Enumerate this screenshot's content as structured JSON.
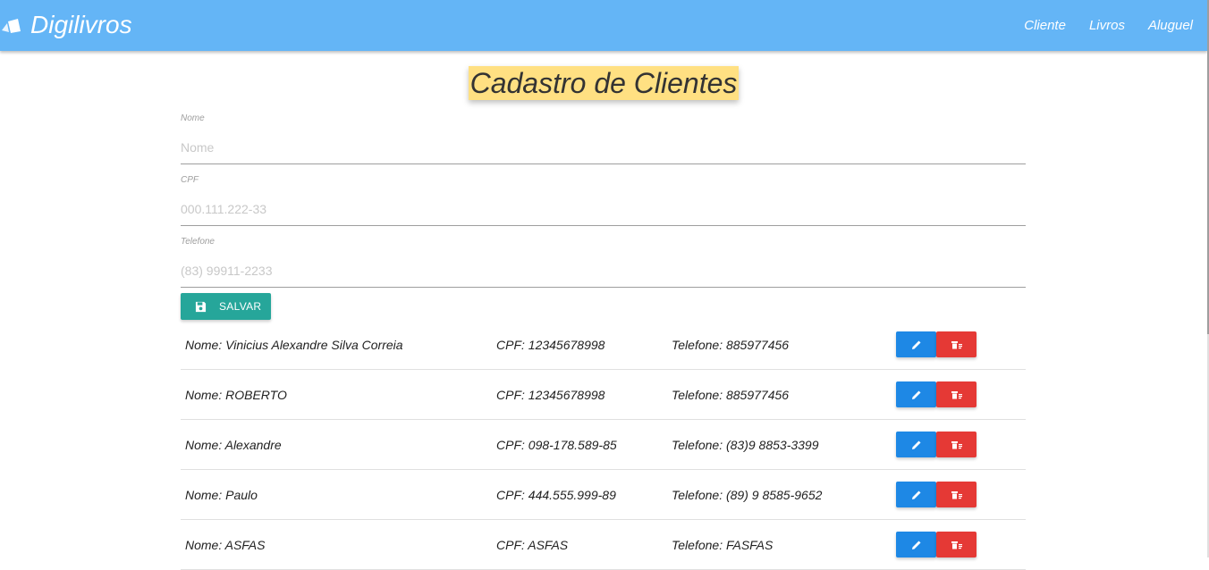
{
  "navbar": {
    "brand": "Digilivros",
    "brand_icon": "book-icon",
    "links": [
      "Cliente",
      "Livros",
      "Aluguel"
    ],
    "color": "#64b5f6"
  },
  "page": {
    "title": "Cadastro de Clientes",
    "title_highlight": "#ffe082"
  },
  "form": {
    "fields": [
      {
        "label": "Nome",
        "placeholder": "Nome",
        "value": ""
      },
      {
        "label": "CPF",
        "placeholder": "000.111.222-33",
        "value": ""
      },
      {
        "label": "Telefone",
        "placeholder": "(83) 99911-2233",
        "value": ""
      }
    ],
    "save_label": "SALVAR",
    "save_icon": "floppy-disk-icon",
    "save_color": "#26a69a"
  },
  "clients": [
    {
      "name": "Nome: Vinicius Alexandre Silva Correia",
      "cpf": "CPF: 12345678998",
      "phone": "Telefone: 885977456"
    },
    {
      "name": "Nome: ROBERTO",
      "cpf": "CPF: 12345678998",
      "phone": "Telefone: 885977456"
    },
    {
      "name": "Nome: Alexandre",
      "cpf": "CPF: 098-178.589-85",
      "phone": "Telefone: (83)9 8853-3399"
    },
    {
      "name": "Nome: Paulo",
      "cpf": "CPF: 444.555.999-89",
      "phone": "Telefone: (89) 9 8585-9652"
    },
    {
      "name": "Nome: ASFAS",
      "cpf": "CPF: ASFAS",
      "phone": "Telefone: FASFAS"
    }
  ],
  "row_actions": {
    "edit_icon": "pencil-icon",
    "edit_color": "#1e88e5",
    "delete_icon": "trash-icon",
    "delete_color": "#e53935"
  }
}
